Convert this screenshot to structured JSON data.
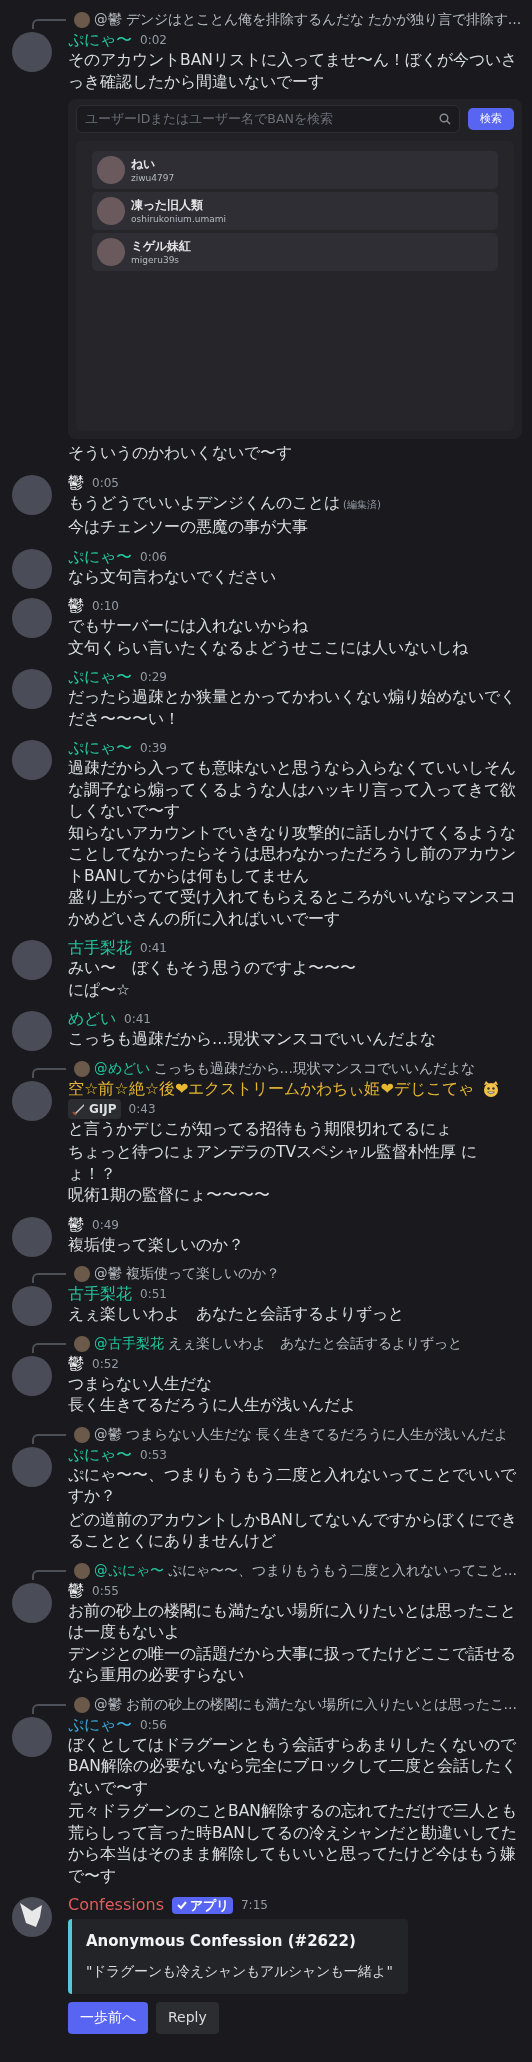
{
  "messages": [
    {
      "reply": {
        "mention": {
          "text": "@鬱",
          "color": "#b5bac1"
        },
        "text": "デンジはとことん俺を排除するんだな たかが独り言で排除す…"
      },
      "author": {
        "name": "ぷにゃ〜",
        "color": "#23c8a0"
      },
      "time": "0:02",
      "blocks": [
        {
          "kind": "text",
          "lines": [
            "そのアカウントBANリストに入ってませ〜ん！ぼくが今ついさっき確認したから間違いないでーす"
          ]
        },
        {
          "kind": "ban_search",
          "placeholder": "ユーザーIDまたはユーザー名でBANを検索",
          "button": "検索",
          "users": [
            {
              "name": "ねい",
              "username": "ziwu4797"
            },
            {
              "name": "凍った旧人類",
              "username": "oshirukonium.umami"
            },
            {
              "name": "ミゲル妹紅",
              "username": "migeru39s"
            }
          ]
        },
        {
          "kind": "text",
          "lines": [
            "そういうのかわいくないで〜す"
          ]
        }
      ]
    },
    {
      "author": {
        "name": "鬱",
        "color": "#f2f3f5"
      },
      "time": "0:05",
      "blocks": [
        {
          "kind": "text",
          "lines": [
            "もうどうでいいよデンジくんのことは"
          ],
          "edited_label": "(編集済)"
        },
        {
          "kind": "text",
          "lines": [
            "今はチェンソーの悪魔の事が大事"
          ]
        }
      ]
    },
    {
      "author": {
        "name": "ぷにゃ〜",
        "color": "#23c8a0"
      },
      "time": "0:06",
      "blocks": [
        {
          "kind": "text",
          "lines": [
            "なら文句言わないでください"
          ]
        }
      ]
    },
    {
      "author": {
        "name": "鬱",
        "color": "#f2f3f5"
      },
      "time": "0:10",
      "blocks": [
        {
          "kind": "text",
          "lines": [
            "でもサーバーには入れないからね",
            "文句くらい言いたくなるよどうせここには人いないしね"
          ]
        }
      ]
    },
    {
      "author": {
        "name": "ぷにゃ〜",
        "color": "#23c8a0"
      },
      "time": "0:29",
      "blocks": [
        {
          "kind": "text",
          "lines": [
            "だったら過疎とか狭量とかってかわいくない煽り始めないでくださ〜〜〜い！"
          ]
        }
      ]
    },
    {
      "author": {
        "name": "ぷにゃ〜",
        "color": "#23c8a0"
      },
      "time": "0:39",
      "blocks": [
        {
          "kind": "text",
          "lines": [
            "過疎だから入っても意味ないと思うなら入らなくていいしそんな調子なら煽ってくるような人はハッキリ言って入ってきて欲しくないで〜す",
            "知らないアカウントでいきなり攻撃的に話しかけてくるようなことしてなかったらそうは思わなかっただろうし前のアカウントBANしてからは何もしてません",
            "盛り上がってて受け入れてもらえるところがいいならマンスコかめどいさんの所に入ればいいでーす"
          ]
        }
      ]
    },
    {
      "author": {
        "name": "古手梨花",
        "color": "#23c8a0"
      },
      "time": "0:41",
      "blocks": [
        {
          "kind": "text",
          "lines": [
            "みい〜　ぼくもそう思うのですよ〜〜〜",
            "にぱ〜☆"
          ]
        }
      ]
    },
    {
      "author": {
        "name": "めどい",
        "color": "#23c8a0"
      },
      "time": "0:41",
      "blocks": [
        {
          "kind": "text",
          "lines": [
            "こっちも過疎だから…現状マンスコでいいんだよな"
          ]
        }
      ]
    },
    {
      "reply": {
        "mention": {
          "text": "@めどい",
          "color": "#23c8a0"
        },
        "text": "こっちも過疎だから…現状マンスコでいいんだよな"
      },
      "author": {
        "name": "空☆前☆絶☆後❤エクストリームかわちぃ姫❤デじこてゃ",
        "color": "#e8b830",
        "emoji": true
      },
      "tag": "GIJP",
      "time": "0:43",
      "blocks": [
        {
          "kind": "text",
          "lines": [
            "と言うかデじこが知ってる招待もう期限切れてるにょ"
          ]
        },
        {
          "kind": "text",
          "lines": [
            "ちょっと待つにょアンデラのTVスペシャル監督朴性厚 にょ！？",
            "呪術1期の監督にょ〜〜〜〜"
          ]
        }
      ]
    },
    {
      "author": {
        "name": "鬱",
        "color": "#f2f3f5"
      },
      "time": "0:49",
      "blocks": [
        {
          "kind": "text",
          "lines": [
            "複垢使って楽しいのか？"
          ]
        }
      ]
    },
    {
      "reply": {
        "mention": {
          "text": "@鬱",
          "color": "#b5bac1"
        },
        "text": "複垢使って楽しいのか？"
      },
      "author": {
        "name": "古手梨花",
        "color": "#23c8a0"
      },
      "time": "0:51",
      "blocks": [
        {
          "kind": "text",
          "lines": [
            "えぇ楽しいわよ　あなたと会話するよりずっと"
          ]
        }
      ]
    },
    {
      "reply": {
        "mention": {
          "text": "@古手梨花",
          "color": "#23c8a0"
        },
        "text": "えぇ楽しいわよ　あなたと会話するよりずっと"
      },
      "author": {
        "name": "鬱",
        "color": "#f2f3f5"
      },
      "time": "0:52",
      "blocks": [
        {
          "kind": "text",
          "lines": [
            "つまらない人生だな",
            "長く生きてるだろうに人生が浅いんだよ"
          ]
        }
      ]
    },
    {
      "reply": {
        "mention": {
          "text": "@鬱",
          "color": "#b5bac1"
        },
        "text": "つまらない人生だな 長く生きてるだろうに人生が浅いんだよ"
      },
      "author": {
        "name": "ぷにゃ〜",
        "color": "#23c8a0"
      },
      "time": "0:53",
      "blocks": [
        {
          "kind": "text",
          "lines": [
            "ぷにゃ〜〜、つまりもうもう二度と入れないってことでいいですか？"
          ]
        },
        {
          "kind": "text",
          "lines": [
            "どの道前のアカウントしかBANしてないんですからぼくにできることとくにありませんけど"
          ]
        }
      ]
    },
    {
      "reply": {
        "mention": {
          "text": "@ぷにゃ〜",
          "color": "#23c8a0"
        },
        "text": "ぷにゃ〜〜、つまりもうもう二度と入れないってこと…"
      },
      "author": {
        "name": "鬱",
        "color": "#f2f3f5"
      },
      "time": "0:55",
      "blocks": [
        {
          "kind": "text",
          "lines": [
            "お前の砂上の楼閣にも満たない場所に入りたいとは思ったことは一度もないよ",
            "デンジとの唯一の話題だから大事に扱ってたけどここで話せるなら重用の必要すらない"
          ]
        }
      ]
    },
    {
      "reply": {
        "mention": {
          "text": "@鬱",
          "color": "#b5bac1"
        },
        "text": "お前の砂上の楼閣にも満たない場所に入りたいとは思ったこ…"
      },
      "author": {
        "name": "ぷにゃ〜",
        "color": "#3aa8d8"
      },
      "time": "0:56",
      "blocks": [
        {
          "kind": "text",
          "lines": [
            "ぼくとしてはドラグーンともう会話すらあまりしたくないのでBAN解除の必要ないなら完全にブロックして二度と会話したくないで〜す"
          ]
        },
        {
          "kind": "text",
          "lines": [
            "元々ドラグーンのことBAN解除するの忘れてただけで三人とも荒らしって言った時BANしてるの冷えシャンだと勘違いしてたから本当はそのまま解除してもいいと思ってたけど今はもう嫌で〜す"
          ]
        }
      ]
    },
    {
      "author": {
        "name": "Confessions",
        "color": "#e25c5c",
        "bot_avatar": true
      },
      "app_badge": "アプリ",
      "time": "7:15",
      "blocks": [
        {
          "kind": "embed",
          "color": "#56c8d8",
          "title": "Anonymous Confession (#2622)",
          "description": "\"ドラグーンも冷えシャンもアルシャンも一緒よ\""
        },
        {
          "kind": "buttons",
          "buttons": [
            {
              "label": "一歩前へ",
              "kind": "primary"
            },
            {
              "label": "Reply",
              "kind": "secondary"
            }
          ]
        }
      ]
    }
  ]
}
